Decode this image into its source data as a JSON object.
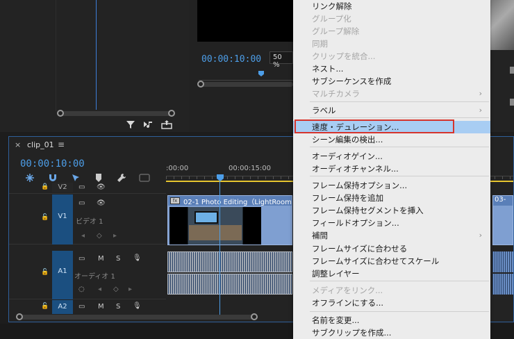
{
  "monitor": {
    "timecode": "00:00:10:00",
    "zoom": "50 %"
  },
  "timeline": {
    "tab_close": "×",
    "tab_label": "clip_01",
    "tab_menu": "≡",
    "timecode": "00:00:10:00",
    "ruler_labels": [
      ":00:00",
      "00:00:15:00"
    ],
    "tracks": {
      "v2": "V2",
      "v1": "V1",
      "v1_sub": "ビデオ 1",
      "a1": "A1",
      "a1_sub": "オーディオ 1",
      "a2": "A2",
      "m": "M",
      "s": "S"
    },
    "clip_video_title": "02-1 Photo Editing（LightRoom",
    "clip_video_right_title": "03-",
    "fx": "fx"
  },
  "context_menu": {
    "items": [
      {
        "label": "リンク解除",
        "disabled": false
      },
      {
        "label": "グループ化",
        "disabled": true
      },
      {
        "label": "グループ解除",
        "disabled": true
      },
      {
        "label": "同期",
        "disabled": true
      },
      {
        "label": "クリップを統合...",
        "disabled": true
      },
      {
        "label": "ネスト...",
        "disabled": false
      },
      {
        "label": "サブシーケンスを作成",
        "disabled": false
      },
      {
        "label": "マルチカメラ",
        "disabled": true,
        "submenu": true
      },
      {
        "label": "ラベル",
        "disabled": false,
        "submenu": true
      },
      {
        "label": "速度・デュレーション...",
        "disabled": false,
        "highlighted": true
      },
      {
        "label": "シーン編集の検出...",
        "disabled": false
      },
      {
        "label": "オーディオゲイン...",
        "disabled": false
      },
      {
        "label": "オーディオチャンネル...",
        "disabled": false
      },
      {
        "label": "フレーム保持オプション...",
        "disabled": false
      },
      {
        "label": "フレーム保持を追加",
        "disabled": false
      },
      {
        "label": "フレーム保持セグメントを挿入",
        "disabled": false
      },
      {
        "label": "フィールドオプション...",
        "disabled": false
      },
      {
        "label": "補間",
        "disabled": false,
        "submenu": true
      },
      {
        "label": "フレームサイズに合わせる",
        "disabled": false
      },
      {
        "label": "フレームサイズに合わせてスケール",
        "disabled": false
      },
      {
        "label": "調整レイヤー",
        "disabled": false
      },
      {
        "label": "メディアをリンク...",
        "disabled": true
      },
      {
        "label": "オフラインにする...",
        "disabled": false
      },
      {
        "label": "名前を変更...",
        "disabled": false
      },
      {
        "label": "サブクリップを作成...",
        "disabled": false
      }
    ],
    "submenu_arrow": "›"
  },
  "colors": {
    "accent_blue": "#4d9ee8",
    "highlight": "#a8cdf3",
    "annotation_red": "#d6342c",
    "work_area_yellow": "#e6c52f"
  }
}
